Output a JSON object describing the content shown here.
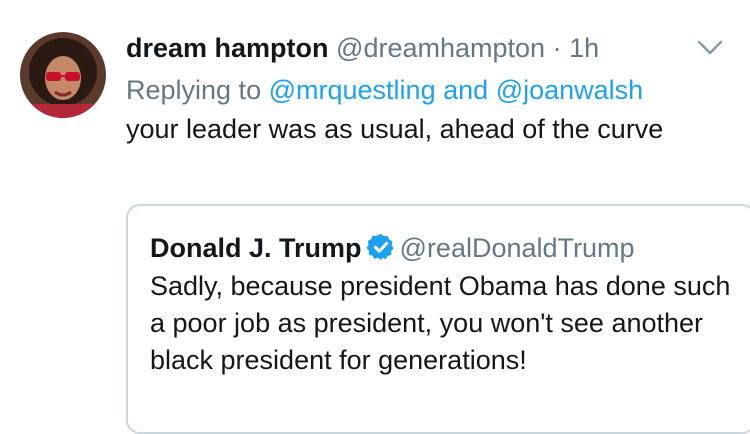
{
  "tweet": {
    "avatar_icon": "profile-photo",
    "name": "dream hampton",
    "handle": "@dreamhampton",
    "separator": "·",
    "time": "1h",
    "menu_icon": "chevron-down-icon",
    "replying_prefix": "Replying to",
    "reply_user1": "@mrquestling",
    "reply_and": "and",
    "reply_user2": "@joanwalsh",
    "text": "your leader was as usual, ahead of the curve"
  },
  "quoted": {
    "name": "Donald J. Trump",
    "verified_icon": "verified-badge-icon",
    "handle": "@realDonaldTrump",
    "text": "Sadly, because president Obama has done such a poor job as president, you won't see another black president for generations!"
  },
  "colors": {
    "link": "#1da1f2",
    "secondary": "#657786",
    "border": "#ccd6dd"
  }
}
